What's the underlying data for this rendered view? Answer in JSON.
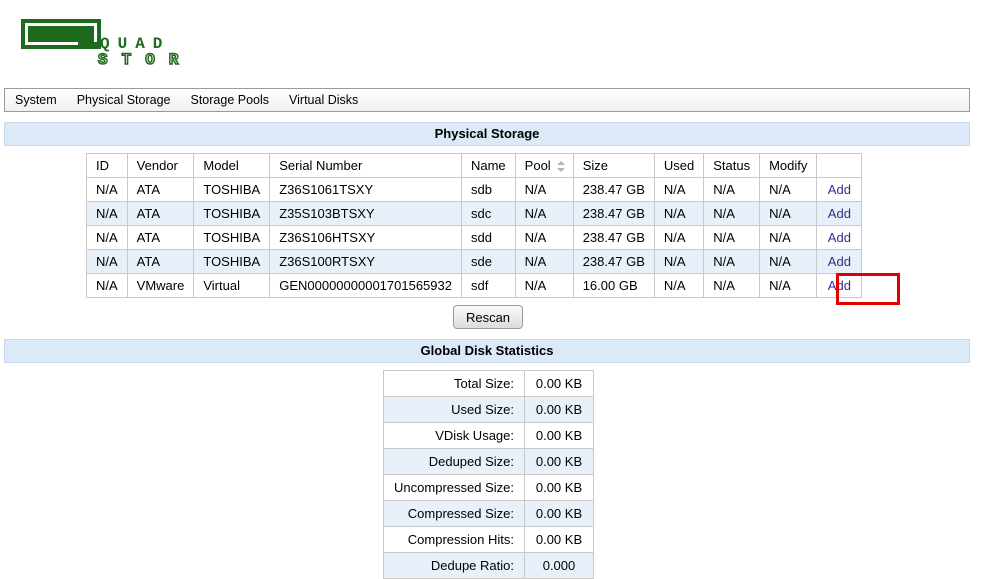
{
  "logo": {
    "line1": "QUAD",
    "line2": "STOR",
    "color": "#1e6b1e"
  },
  "menu": [
    "System",
    "Physical Storage",
    "Storage Pools",
    "Virtual Disks"
  ],
  "physical": {
    "title": "Physical Storage",
    "columns": [
      "ID",
      "Vendor",
      "Model",
      "Serial Number",
      "Name",
      "Pool",
      "Size",
      "Used",
      "Status",
      "Modify",
      ""
    ],
    "rows": [
      [
        "N/A",
        "ATA",
        "TOSHIBA",
        "Z36S1061TSXY",
        "sdb",
        "N/A",
        "238.47 GB",
        "N/A",
        "N/A",
        "N/A",
        "Add"
      ],
      [
        "N/A",
        "ATA",
        "TOSHIBA",
        "Z35S103BTSXY",
        "sdc",
        "N/A",
        "238.47 GB",
        "N/A",
        "N/A",
        "N/A",
        "Add"
      ],
      [
        "N/A",
        "ATA",
        "TOSHIBA",
        "Z36S106HTSXY",
        "sdd",
        "N/A",
        "238.47 GB",
        "N/A",
        "N/A",
        "N/A",
        "Add"
      ],
      [
        "N/A",
        "ATA",
        "TOSHIBA",
        "Z36S100RTSXY",
        "sde",
        "N/A",
        "238.47 GB",
        "N/A",
        "N/A",
        "N/A",
        "Add"
      ],
      [
        "N/A",
        "VMware",
        "Virtual",
        "GEN00000000001701565932",
        "sdf",
        "N/A",
        "16.00 GB",
        "N/A",
        "N/A",
        "N/A",
        "Add"
      ]
    ],
    "rescan_label": "Rescan"
  },
  "stats": {
    "title": "Global Disk Statistics",
    "rows": [
      [
        "Total Size:",
        "0.00 KB"
      ],
      [
        "Used Size:",
        "0.00 KB"
      ],
      [
        "VDisk Usage:",
        "0.00 KB"
      ],
      [
        "Deduped Size:",
        "0.00 KB"
      ],
      [
        "Uncompressed Size:",
        "0.00 KB"
      ],
      [
        "Compressed Size:",
        "0.00 KB"
      ],
      [
        "Compression Hits:",
        "0.00 KB"
      ],
      [
        "Dedupe Ratio:",
        "0.000"
      ]
    ]
  }
}
